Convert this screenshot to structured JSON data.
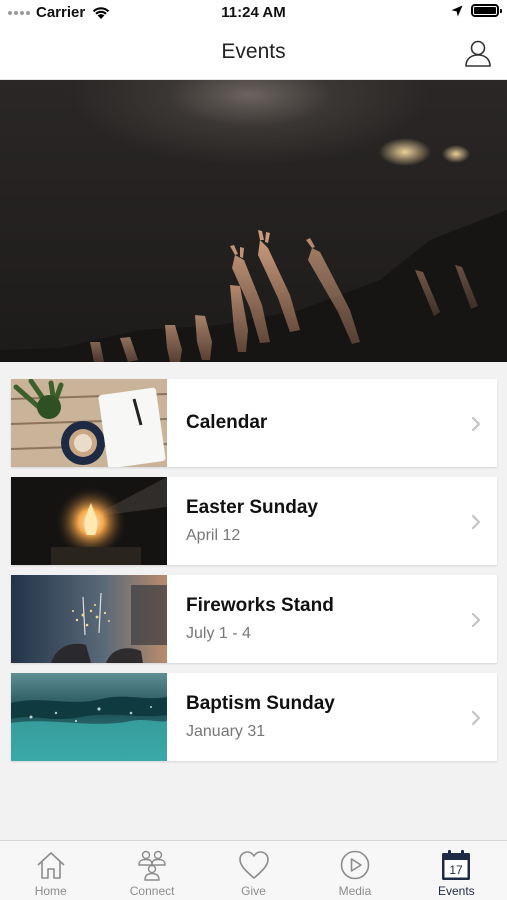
{
  "status_bar": {
    "carrier": "Carrier",
    "time": "11:24 AM"
  },
  "header": {
    "title": "Events",
    "profile_icon": "user-icon"
  },
  "hero": {
    "description_icon": "hero-image"
  },
  "events": [
    {
      "title": "Calendar",
      "date": "",
      "thumb": "calendar-thumb"
    },
    {
      "title": "Easter Sunday",
      "date": "April 12",
      "thumb": "fire-thumb"
    },
    {
      "title": "Fireworks Stand",
      "date": "July 1 - 4",
      "thumb": "sparkler-thumb"
    },
    {
      "title": "Baptism Sunday",
      "date": "January 31",
      "thumb": "water-thumb"
    }
  ],
  "tabs": [
    {
      "label": "Home",
      "icon": "home-icon",
      "active": false
    },
    {
      "label": "Connect",
      "icon": "people-icon",
      "active": false
    },
    {
      "label": "Give",
      "icon": "heart-icon",
      "active": false
    },
    {
      "label": "Media",
      "icon": "play-icon",
      "active": false
    },
    {
      "label": "Events",
      "icon": "calendar-icon",
      "active": true
    }
  ],
  "colors": {
    "accent": "#1f2a44",
    "inactive": "#8c8c8c",
    "background": "#f2f2f2"
  }
}
